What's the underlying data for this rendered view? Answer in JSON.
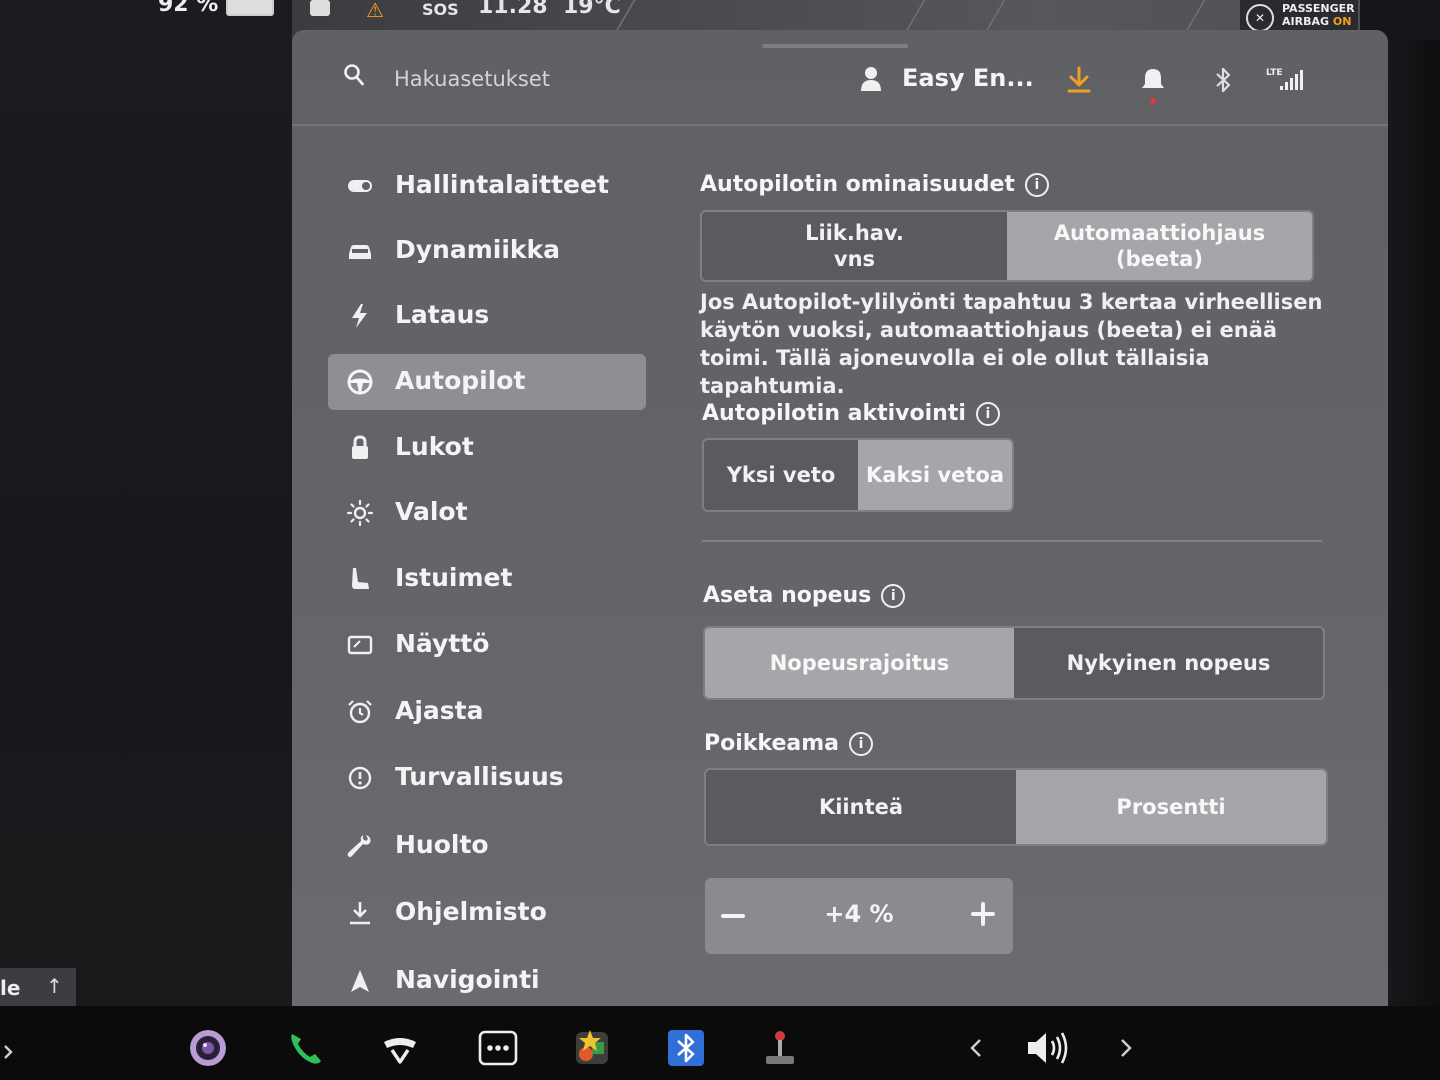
{
  "status": {
    "battery": "92 %",
    "sos": "SOS",
    "time": "11.28",
    "temperature": "19°C",
    "airbag_line1": "PASSENGER",
    "airbag_line2": "AIRBAG",
    "airbag_state": "ON"
  },
  "header": {
    "search_placeholder": "Hakuasetukset",
    "profile_name": "Easy En...",
    "network": "LTE",
    "colors": {
      "download": "#f0a020",
      "notification_dot": "#e53935"
    }
  },
  "sidebar": {
    "items": [
      {
        "label": "Hallintalaitteet",
        "icon": "toggle-icon"
      },
      {
        "label": "Dynamiikka",
        "icon": "car-icon"
      },
      {
        "label": "Lataus",
        "icon": "lightning-icon"
      },
      {
        "label": "Autopilot",
        "icon": "steering-wheel-icon",
        "active": true
      },
      {
        "label": "Lukot",
        "icon": "lock-icon"
      },
      {
        "label": "Valot",
        "icon": "sun-icon"
      },
      {
        "label": "Istuimet",
        "icon": "seat-icon"
      },
      {
        "label": "Näyttö",
        "icon": "display-icon"
      },
      {
        "label": "Ajasta",
        "icon": "alarm-clock-icon"
      },
      {
        "label": "Turvallisuus",
        "icon": "alert-circle-icon"
      },
      {
        "label": "Huolto",
        "icon": "wrench-icon"
      },
      {
        "label": "Ohjelmisto",
        "icon": "download-icon"
      },
      {
        "label": "Navigointi",
        "icon": "navigation-icon"
      }
    ]
  },
  "autopilot": {
    "features": {
      "title": "Autopilotin ominaisuudet",
      "options": [
        "Liik.hav.\nvns",
        "Automaattiohjaus\n(beeta)"
      ],
      "selected": 1,
      "description": "Jos Autopilot-ylilyönti tapahtuu 3 kertaa virheellisen käytön vuoksi, automaattiohjaus (beeta) ei enää toimi. Tällä ajoneuvolla ei ole ollut tällaisia tapahtumia."
    },
    "activation": {
      "title": "Autopilotin aktivointi",
      "options": [
        "Yksi veto",
        "Kaksi vetoa"
      ],
      "selected": 1
    },
    "set_speed": {
      "title": "Aseta nopeus",
      "options": [
        "Nopeusrajoitus",
        "Nykyinen nopeus"
      ],
      "selected": 0
    },
    "offset": {
      "title": "Poikkeama",
      "options": [
        "Kiinteä",
        "Prosentti"
      ],
      "selected": 1,
      "value": "+4 %"
    }
  },
  "bottom": {
    "left_tab_text": "le",
    "left_tab_arrow": "↑"
  }
}
